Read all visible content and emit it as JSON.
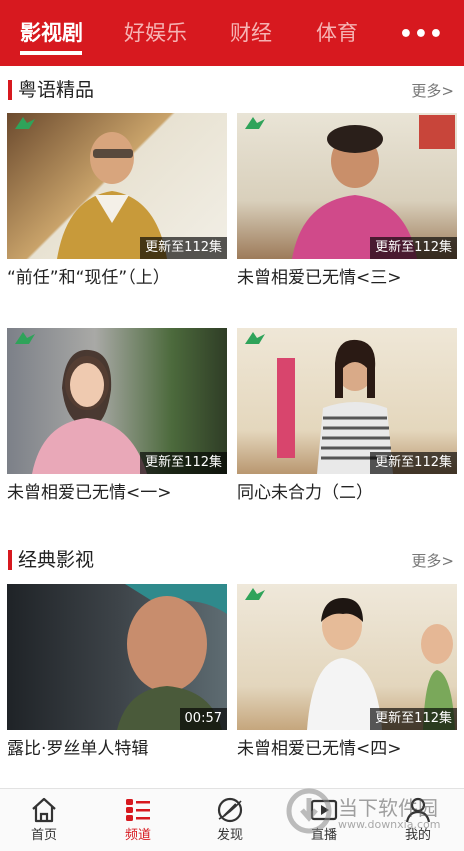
{
  "top_tabs": [
    {
      "label": "影视剧",
      "active": true
    },
    {
      "label": "好娱乐",
      "active": false
    },
    {
      "label": "财经",
      "active": false
    },
    {
      "label": "体育",
      "active": false
    }
  ],
  "top_more_icon": "more-dots-icon",
  "sections": [
    {
      "title": "粤语精品",
      "more": "更多>",
      "cards": [
        {
          "caption": "“前任”和“现任”（上）",
          "badge": "更新至112集"
        },
        {
          "caption": "未曾相爱已无情<三>",
          "badge": "更新至112集"
        },
        {
          "caption": "未曾相爱已无情<一>",
          "badge": "更新至112集"
        },
        {
          "caption": "同心未合力（二）",
          "badge": "更新至112集"
        }
      ]
    },
    {
      "title": "经典影视",
      "more": "更多>",
      "cards": [
        {
          "caption": "露比·罗丝单人特辑",
          "badge": "00:57"
        },
        {
          "caption": "未曾相爱已无情<四>",
          "badge": "更新至112集"
        }
      ]
    }
  ],
  "bottom_nav": [
    {
      "label": "首页",
      "icon": "home-icon",
      "active": false
    },
    {
      "label": "频道",
      "icon": "channel-list-icon",
      "active": true
    },
    {
      "label": "发现",
      "icon": "discover-icon",
      "active": false
    },
    {
      "label": "直播",
      "icon": "live-play-icon",
      "active": false
    },
    {
      "label": "我的",
      "icon": "profile-icon",
      "active": false
    }
  ],
  "watermark": {
    "text": "当下软件园",
    "url": "www.downxia.com"
  },
  "colors": {
    "brand_red": "#d7191f",
    "tab_inactive": "#f6b3b3"
  }
}
